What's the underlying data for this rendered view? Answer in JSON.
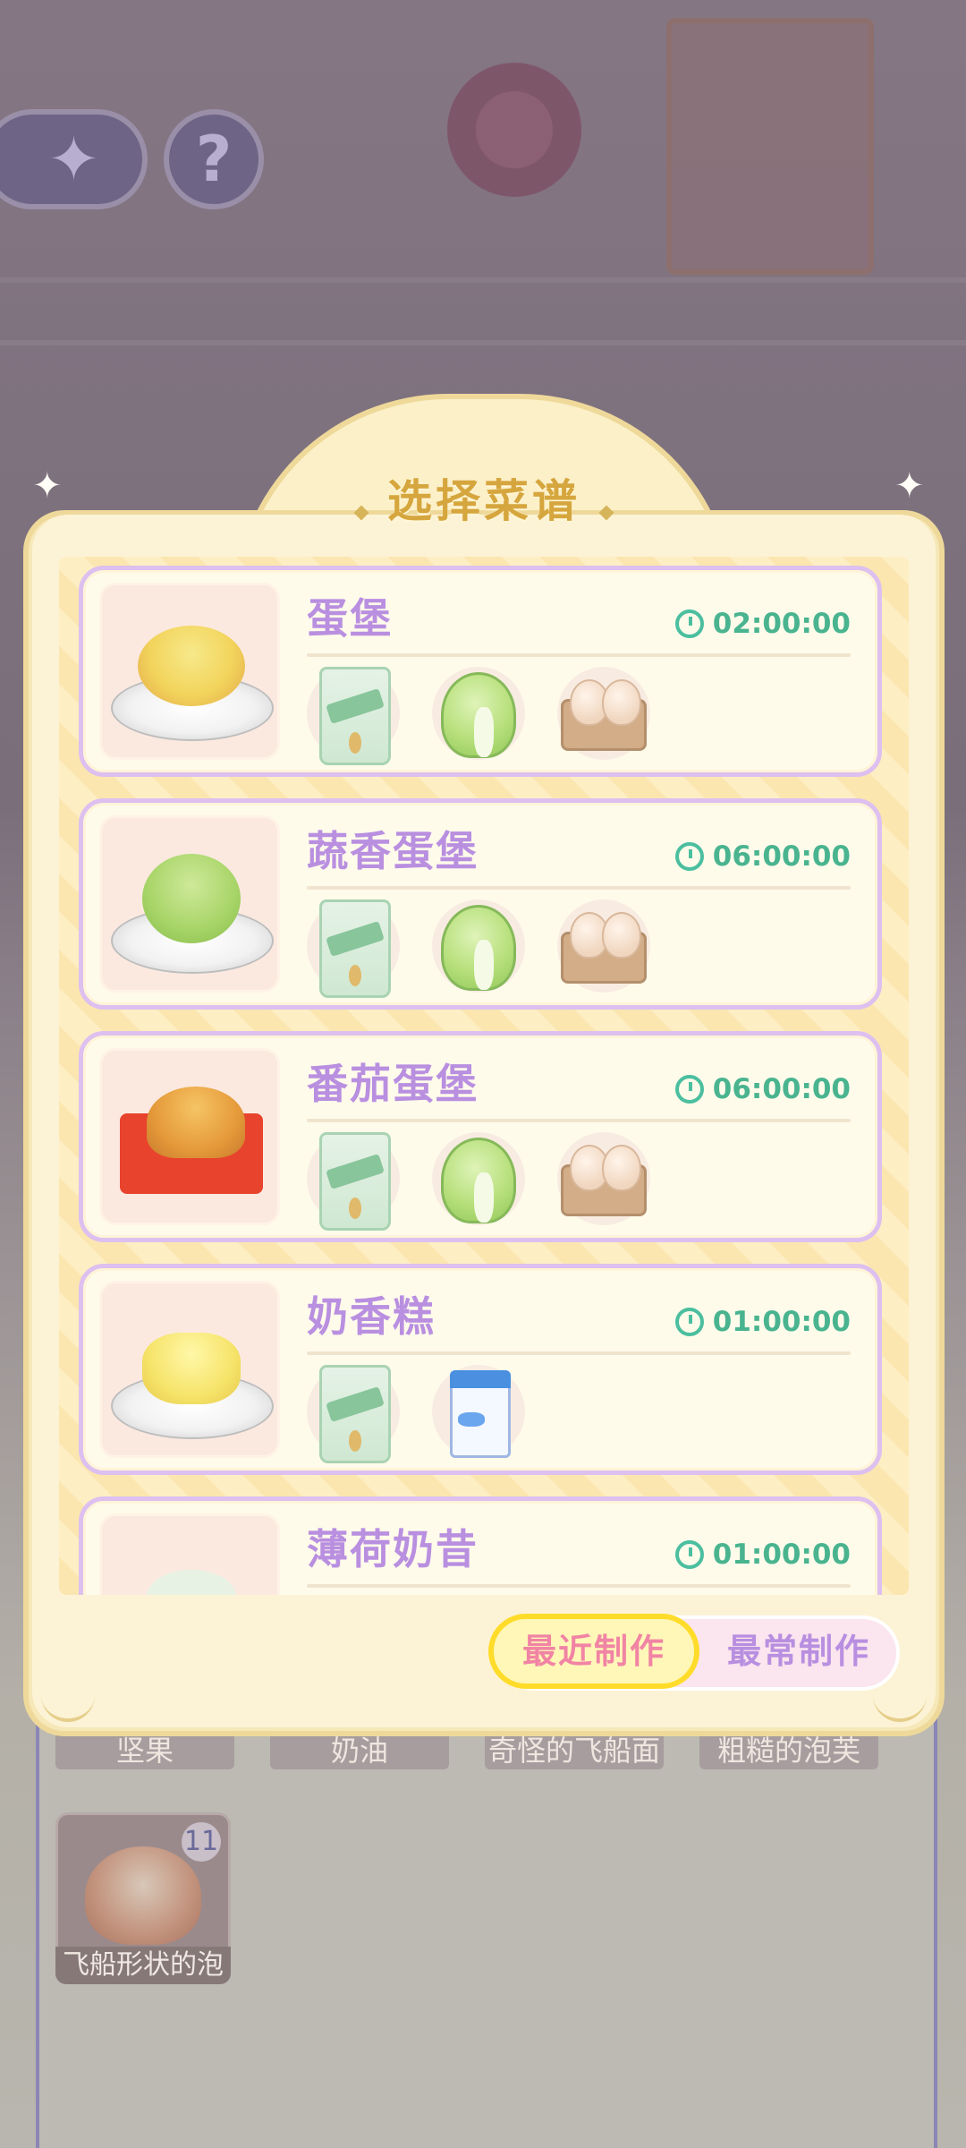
{
  "background": {
    "labels": [
      "坚果",
      "奶油",
      "奇怪的飞船面",
      "粗糙的泡芙"
    ],
    "item": {
      "name": "飞船形状的泡",
      "count": "11"
    }
  },
  "dialog": {
    "title": "选择菜谱",
    "recipes": [
      {
        "name": "蛋堡",
        "time": "02:00:00",
        "ingredients": [
          "flour-icon",
          "cabbage-icon",
          "eggs-icon"
        ]
      },
      {
        "name": "蔬香蛋堡",
        "time": "06:00:00",
        "ingredients": [
          "flour-icon",
          "cabbage-icon",
          "eggs-icon"
        ]
      },
      {
        "name": "番茄蛋堡",
        "time": "06:00:00",
        "ingredients": [
          "flour-icon",
          "cabbage-icon",
          "eggs-icon"
        ]
      },
      {
        "name": "奶香糕",
        "time": "01:00:00",
        "ingredients": [
          "flour-icon",
          "milk-icon"
        ]
      },
      {
        "name": "薄荷奶昔",
        "time": "01:00:00",
        "ingredients": []
      }
    ],
    "tabs": {
      "recent": "最近制作",
      "frequent": "最常制作",
      "selected": "recent"
    }
  },
  "colors": {
    "recipe_name": "#b98fe0",
    "timer": "#49b48f",
    "title": "#d6a63e",
    "active_tab_text": "#f184a4"
  }
}
